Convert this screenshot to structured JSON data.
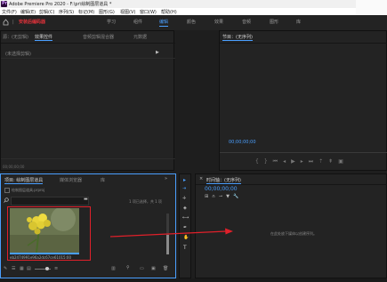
{
  "window": {
    "title": "Adobe Premiere Pro 2020 - F:\\pr\\绘制图层道具 *"
  },
  "menu": [
    "文件(F)",
    "编辑(E)",
    "剪辑(C)",
    "序列(S)",
    "标记(M)",
    "图形(G)",
    "视图(V)",
    "窗口(W)",
    "帮助(H)"
  ],
  "workspace": {
    "title": "安装后编码器",
    "tabs": [
      "学习",
      "组件",
      "编辑",
      "颜色",
      "效果",
      "音频",
      "图形",
      "库"
    ],
    "active": "编辑"
  },
  "source_panel": {
    "tabs": [
      "源：(无剪辑)",
      "效果控件",
      "音频剪辑混合器",
      "元数据"
    ],
    "active": "效果控件",
    "empty_text": "(未选择剪辑)",
    "timecode": "00;00;00;00"
  },
  "program_panel": {
    "title": "节目：(无序列)",
    "timecode": "00;00;00;00"
  },
  "project_panel": {
    "tabs": [
      "项目: 绘制图层道具",
      "媒体浏览器",
      "库"
    ],
    "project_file": "绘制图层道具.prproj",
    "selection_info": "1 项已选择，共 1 项",
    "clip_name": "eb2474991e96a2dc67ce61014...",
    "clip_duration": "5:00"
  },
  "timeline_panel": {
    "title": "时间轴：(无序列)",
    "timecode": "00;00;00;00",
    "hint": "在此处放下媒体以创建序列。"
  },
  "colors": {
    "accent_blue": "#4a9fff",
    "workspace_title_red": "#e0323a",
    "annotation_red": "#e0202a",
    "flower_yellow": "#e8d43a"
  }
}
